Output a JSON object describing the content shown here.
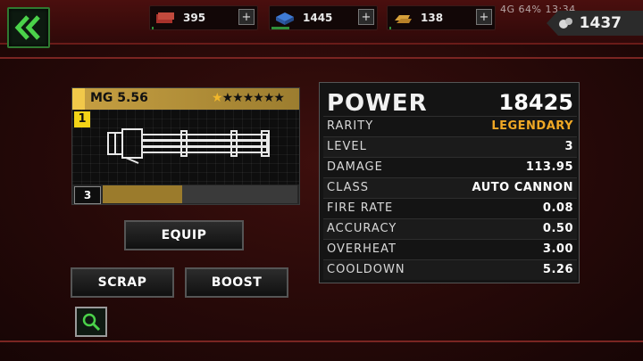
{
  "statusbar": {
    "text": "4G 64% 13:34"
  },
  "resources": [
    {
      "icon": "cash-stack-icon",
      "value": "395",
      "plus": "+",
      "fill": 0.02
    },
    {
      "icon": "supply-crate-icon",
      "value": "1445",
      "plus": "+",
      "fill": 0.17
    },
    {
      "icon": "gold-bars-icon",
      "value": "138",
      "plus": "+",
      "fill": 0.01
    }
  ],
  "gems": {
    "icon": "gem-icon",
    "value": "1437"
  },
  "weapon": {
    "name": "MG 5.56",
    "tier": "1",
    "level": "3",
    "stars_filled": 1,
    "stars_total": 7,
    "xp_progress": 0.41
  },
  "actions": {
    "equip": "EQUIP",
    "scrap": "SCRAP",
    "boost": "BOOST"
  },
  "stats": {
    "power_label": "POWER",
    "power_value": "18425",
    "rows": [
      {
        "label": "RARITY",
        "value": "LEGENDARY"
      },
      {
        "label": "LEVEL",
        "value": "3"
      },
      {
        "label": "DAMAGE",
        "value": "113.95"
      },
      {
        "label": "CLASS",
        "value": "AUTO CANNON"
      },
      {
        "label": "FIRE RATE",
        "value": "0.08"
      },
      {
        "label": "ACCURACY",
        "value": "0.50"
      },
      {
        "label": "OVERHEAT",
        "value": "3.00"
      },
      {
        "label": "COOLDOWN",
        "value": "5.26"
      }
    ]
  },
  "colors": {
    "rarity_legendary": "#f0a825",
    "accent_green": "#2f8f3a",
    "card_gold": "#c7a042"
  }
}
